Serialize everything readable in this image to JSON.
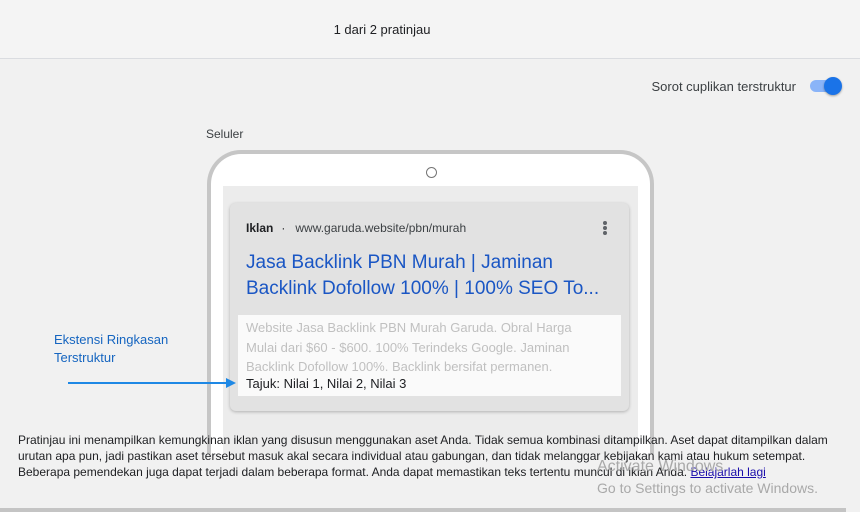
{
  "header": {
    "title": "1 dari 2 pratinjau"
  },
  "toggle": {
    "label": "Sorot cuplikan terstruktur",
    "on": true,
    "color": "#1a73e8"
  },
  "device": {
    "label": "Seluler"
  },
  "ad": {
    "badge": "Iklan",
    "separator": "·",
    "url": "www.garuda.website/pbn/murah",
    "headline": "Jasa Backlink PBN Murah | Jaminan Backlink Dofollow 100% | 100% SEO To...",
    "description": "Website Jasa Backlink PBN Murah Garuda. Obral Harga Mulai dari $60 - $600. 100% Terindeks Google. Jaminan Backlink Dofollow 100%. Backlink bersifat permanen.",
    "structured_snippet": "Tajuk: Nilai 1, Nilai 2, Nilai 3",
    "headline_color": "#1a56c4"
  },
  "annotation": {
    "text_line1": "Ekstensi Ringkasan",
    "text_line2": "Terstruktur",
    "color": "#1565c0"
  },
  "footer": {
    "text": "Pratinjau ini menampilkan kemungkinan iklan yang disusun menggunakan aset Anda. Tidak semua kombinasi ditampilkan. Aset dapat ditampilkan dalam urutan apa pun, jadi pastikan aset tersebut masuk akal secara individual atau gabungan, dan tidak melanggar kebijakan kami atau hukum setempat. Beberapa pemendekan juga dapat terjadi dalam beberapa format. Anda dapat memastikan teks tertentu muncul di iklan Anda.",
    "link": "Belajarlah lagi"
  },
  "watermark": {
    "line1": "Activate Windows",
    "line2": "Go to Settings to activate Windows."
  }
}
